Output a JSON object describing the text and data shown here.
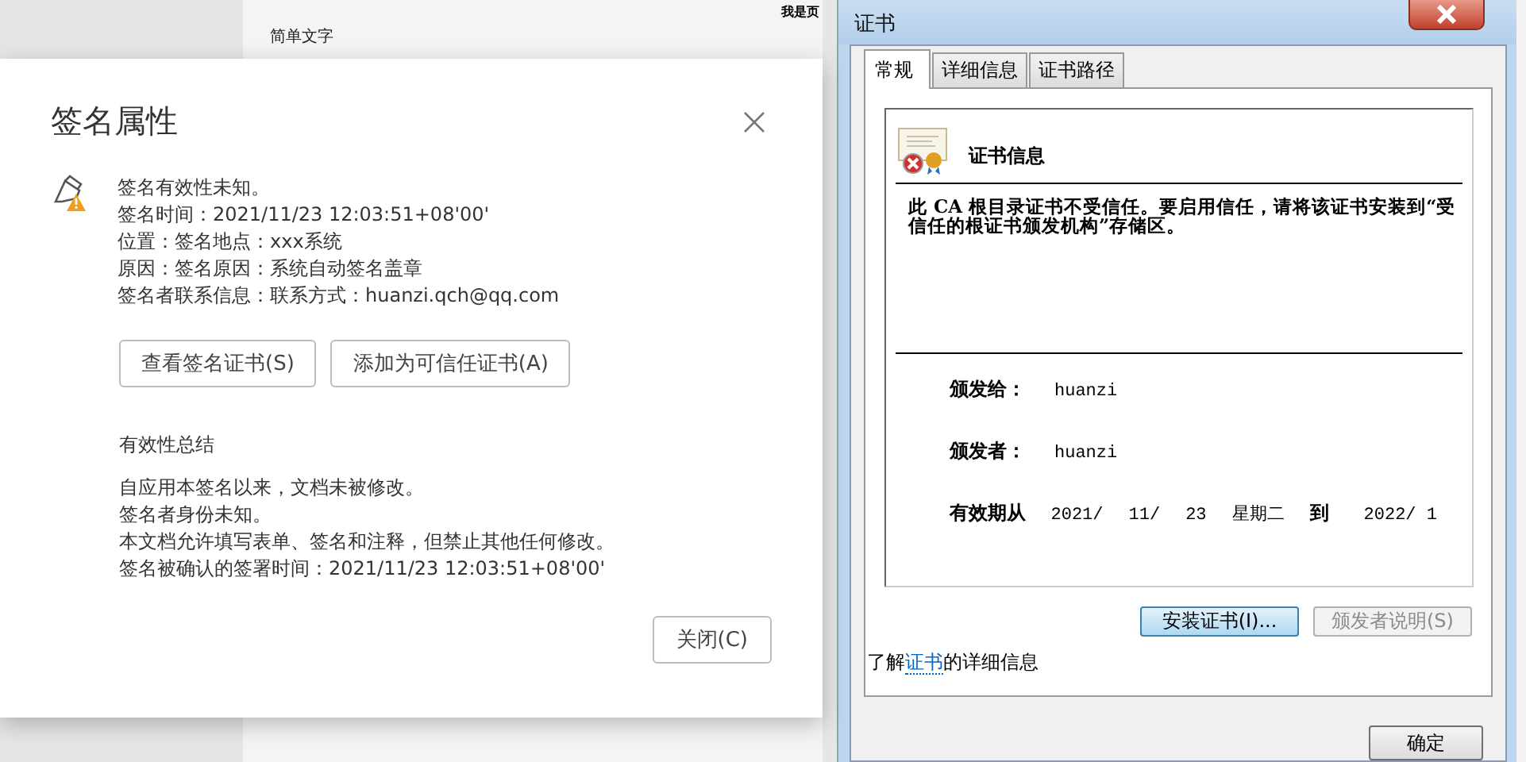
{
  "background_document": {
    "heading": "简单文字",
    "header_text": "我是页"
  },
  "signature_dialog": {
    "title": "签名属性",
    "status_lines": [
      "签名有效性未知。",
      "签名时间：2021/11/23 12:03:51+08'00'",
      "位置：签名地点：xxx系统",
      "原因：签名原因：系统自动签名盖章",
      "签名者联系信息：联系方式：huanzi.qch@qq.com"
    ],
    "buttons": [
      {
        "label": "查看签名证书(S)"
      },
      {
        "label": "添加为可信任证书(A)"
      }
    ],
    "summary_title": "有效性总结",
    "summary_lines": [
      "自应用本签名以来，文档未被修改。",
      "签名者身份未知。",
      "本文档允许填写表单、签名和注释，但禁止其他任何修改。",
      "签名被确认的签署时间：2021/11/23 12:03:51+08'00'"
    ],
    "close_button": "关闭(C)"
  },
  "certificate_window": {
    "title": "证书",
    "tabs": [
      {
        "label": "常规",
        "selected": true
      },
      {
        "label": "详细信息",
        "selected": false
      },
      {
        "label": "证书路径",
        "selected": false
      }
    ],
    "section_title": "证书信息",
    "warning": "此 CA 根目录证书不受信任。要启用信任，请将该证书安装到“受信任的根证书颁发机构”存储区。",
    "fields": [
      {
        "label": "颁发给：",
        "value": "huanzi"
      },
      {
        "label": "颁发者：",
        "value": "huanzi"
      }
    ],
    "validity": {
      "label": "有效期从",
      "from": [
        "2021/",
        "11/",
        "23",
        "星期二"
      ],
      "to_label": "到",
      "to": "2022/ 1"
    },
    "buttons": [
      {
        "label": "安装证书(I)...",
        "disabled": false
      },
      {
        "label": "颁发者说明(S)",
        "disabled": true
      }
    ],
    "learn_more": {
      "before": "了解",
      "link": "证书",
      "after": "的详细信息"
    },
    "ok_button": "确定"
  }
}
